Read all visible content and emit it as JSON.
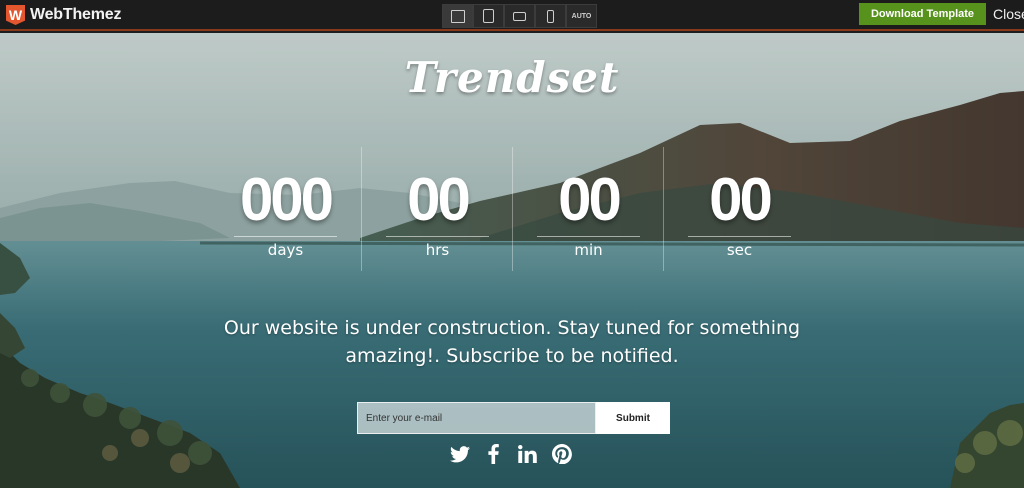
{
  "topbar": {
    "brand_logo_letter": "W",
    "brand_name": "WebThemez",
    "device_buttons": [
      {
        "icon": "desktop-icon"
      },
      {
        "icon": "tablet-icon"
      },
      {
        "icon": "tablet-landscape-icon"
      },
      {
        "icon": "phone-icon"
      },
      {
        "icon": "auto-icon",
        "label": "AUTO"
      }
    ],
    "download_label": "Download Template",
    "close_label": "Close",
    "colors": {
      "bar": "#1c1c1c",
      "download": "#57921c",
      "logo": "#e4572e"
    }
  },
  "hero": {
    "title": "Trendset",
    "countdown": [
      {
        "value": "000",
        "label": "days"
      },
      {
        "value": "00",
        "label": "hrs"
      },
      {
        "value": "00",
        "label": "min"
      },
      {
        "value": "00",
        "label": "sec"
      }
    ],
    "message": "Our website is under construction. Stay tuned for something amazing!. Subscribe to be notified.",
    "email_placeholder": "Enter your e-mail",
    "submit_label": "Submit",
    "social": [
      {
        "icon": "twitter-icon"
      },
      {
        "icon": "facebook-icon"
      },
      {
        "icon": "linkedin-icon"
      },
      {
        "icon": "pinterest-icon"
      }
    ]
  }
}
